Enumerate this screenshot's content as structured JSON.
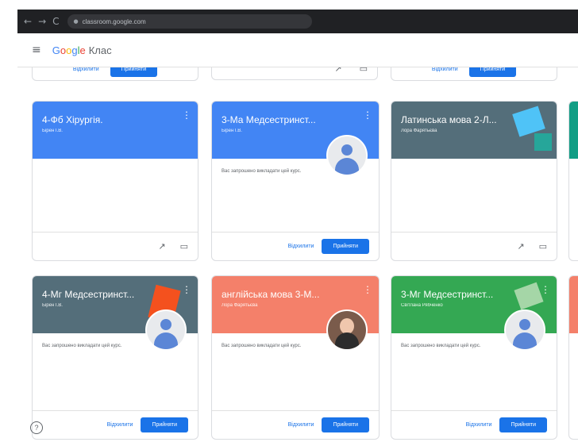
{
  "browser": {
    "url": "classroom.google.com"
  },
  "app": {
    "brand_google": [
      "G",
      "o",
      "o",
      "g",
      "l",
      "e"
    ],
    "brand_suffix": "Клас"
  },
  "actions": {
    "decline": "Відхилити",
    "accept": "Прийняти"
  },
  "invite_text": "Вас запрошено викладати цей курс.",
  "cards": [
    {
      "title": "4-Фб Хірургія.",
      "subtitle": "Бірен І.В.",
      "color": "#4285F4",
      "invited": false
    },
    {
      "title": "3-Ма Медсестринст...",
      "subtitle": "Бірен І.В.",
      "color": "#4285F4",
      "invited": true
    },
    {
      "title": "Латинська мова 2-Л...",
      "subtitle": "Лора Фарятьєва",
      "color": "#546E7A",
      "invited": false
    },
    {
      "title": "4-Мг Медсестринст...",
      "subtitle": "Бірен І.В.",
      "color": "#546E7A",
      "invited": true
    },
    {
      "title": "англійська мова 3-М...",
      "subtitle": "Лора Фарятьєва",
      "color": "#F4806A",
      "invited": true
    },
    {
      "title": "3-Мг Медсестринст...",
      "subtitle": "Світлана Рябченко",
      "color": "#34A853",
      "invited": true
    }
  ],
  "partial_right_colors": [
    "#129E85",
    "#F4806A"
  ]
}
